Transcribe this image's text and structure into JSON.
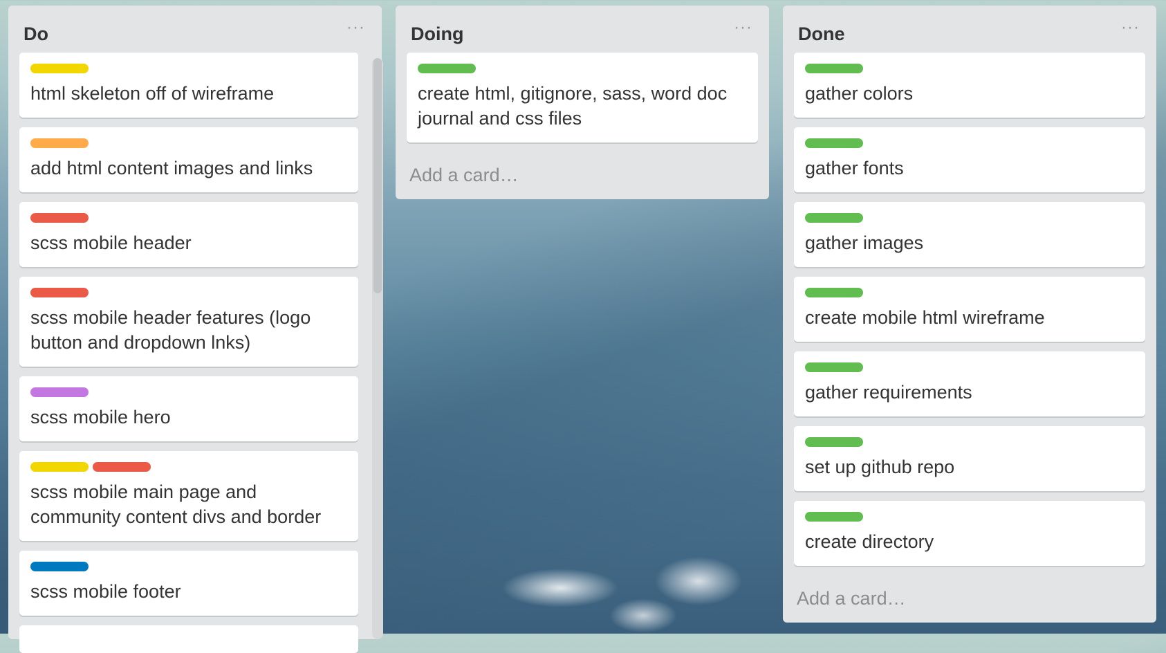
{
  "colors": {
    "yellow": "#f2d600",
    "orange": "#ffab4a",
    "red": "#eb5a46",
    "purple": "#c377e0",
    "blue": "#0079bf",
    "green": "#61bd4f"
  },
  "lists": [
    {
      "title": "Do",
      "cards": [
        {
          "labels": [
            "yellow"
          ],
          "text": "html skeleton off of wireframe"
        },
        {
          "labels": [
            "orange"
          ],
          "text": "add html content images and links"
        },
        {
          "labels": [
            "red"
          ],
          "text": "scss mobile header"
        },
        {
          "labels": [
            "red"
          ],
          "text": "scss mobile header features (logo button and dropdown lnks)"
        },
        {
          "labels": [
            "purple"
          ],
          "text": "scss mobile hero"
        },
        {
          "labels": [
            "yellow",
            "red"
          ],
          "text": "scss mobile main page and community content divs and border"
        },
        {
          "labels": [
            "blue"
          ],
          "text": "scss mobile footer"
        }
      ]
    },
    {
      "title": "Doing",
      "cards": [
        {
          "labels": [
            "green"
          ],
          "text": "create html, gitignore, sass, word doc journal and css files"
        }
      ],
      "add_card": "Add a card…"
    },
    {
      "title": "Done",
      "cards": [
        {
          "labels": [
            "green"
          ],
          "text": "gather colors"
        },
        {
          "labels": [
            "green"
          ],
          "text": "gather fonts"
        },
        {
          "labels": [
            "green"
          ],
          "text": "gather images"
        },
        {
          "labels": [
            "green"
          ],
          "text": "create mobile html wireframe"
        },
        {
          "labels": [
            "green"
          ],
          "text": "gather requirements"
        },
        {
          "labels": [
            "green"
          ],
          "text": "set up github repo"
        },
        {
          "labels": [
            "green"
          ],
          "text": "create directory"
        }
      ],
      "add_card": "Add a card…"
    }
  ],
  "list_menu_icon": "more-horizontal-icon"
}
